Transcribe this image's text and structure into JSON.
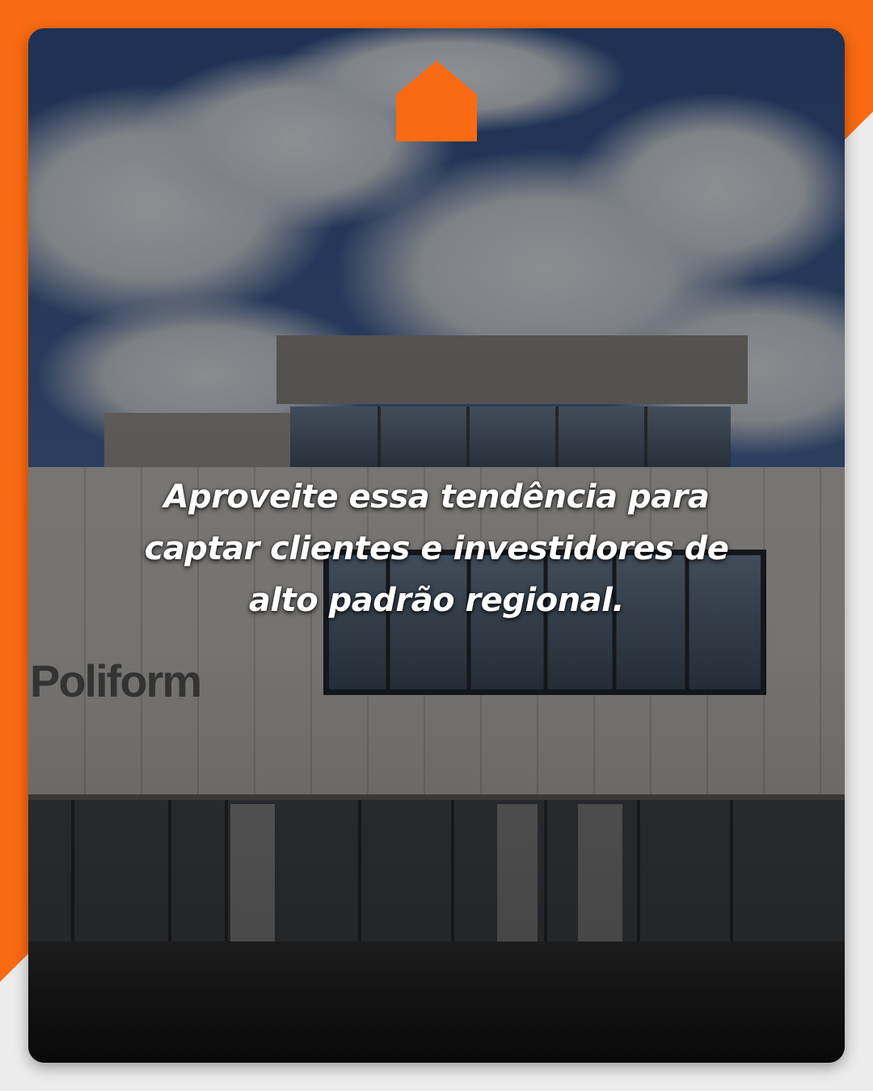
{
  "headline": {
    "line1": "Aproveite essa tendência para",
    "line2": "captar clientes e investidores de",
    "line3": "alto padrão regional."
  },
  "background_photo": {
    "sign_text": "Poliform"
  },
  "logo": {
    "icon": "house-icon",
    "color": "#F96A12"
  },
  "colors": {
    "accent": "#F96A12",
    "frame": "#ECECEC",
    "text": "#FFFFFF"
  }
}
